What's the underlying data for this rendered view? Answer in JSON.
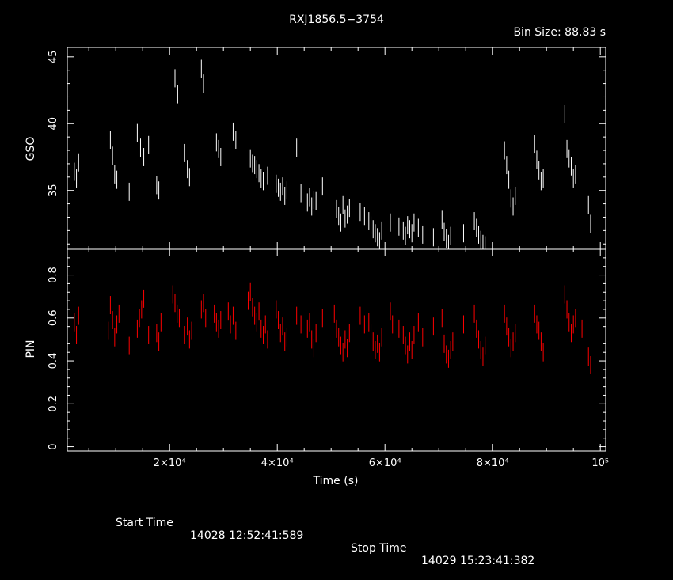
{
  "chart_data": [
    {
      "type": "scatter",
      "title": "RXJ1856.5−3754",
      "subtitle": "Bin Size: 88.83 s",
      "xlabel": "Time (s)",
      "ylabel": "GSO",
      "xlim": [
        1000,
        101000
      ],
      "ylim": [
        30.6,
        45.7
      ],
      "yticks": [
        35,
        40,
        45
      ],
      "series": [
        {
          "color": "#ffffff",
          "x": [
            2300,
            2700,
            3100,
            9000,
            9400,
            9800,
            10200,
            12500,
            14000,
            14600,
            15200,
            16100,
            17600,
            18000,
            21000,
            21500,
            22800,
            23300,
            23700,
            25900,
            26300,
            28700,
            29100,
            29500,
            31800,
            32300,
            35000,
            35400,
            35800,
            36200,
            36600,
            37000,
            37400,
            38200,
            39800,
            40200,
            40600,
            41000,
            41400,
            41800,
            43600,
            44400,
            45600,
            46000,
            46400,
            46800,
            47200,
            48400,
            51000,
            51400,
            51800,
            52200,
            52600,
            53000,
            53400,
            55400,
            56200,
            57000,
            57400,
            57800,
            58200,
            58600,
            59000,
            59400,
            61000,
            62600,
            63400,
            63800,
            64200,
            64600,
            65000,
            65400,
            66200,
            67000,
            69000,
            70600,
            71000,
            71400,
            71800,
            72200,
            74600,
            76600,
            77000,
            77400,
            77800,
            78200,
            78600,
            82200,
            82600,
            83000,
            83400,
            83800,
            84200,
            87800,
            88200,
            88600,
            89000,
            89400,
            93400,
            93800,
            94200,
            94600,
            95000,
            95400,
            97800,
            98200
          ],
          "y": [
            36.4,
            35.9,
            37.1,
            38.8,
            37.6,
            36.2,
            35.8,
            34.9,
            39.3,
            38.2,
            37.5,
            38.4,
            35.4,
            35.0,
            43.4,
            42.2,
            37.8,
            36.6,
            36.0,
            44.1,
            43.0,
            38.6,
            38.1,
            37.5,
            39.4,
            38.8,
            37.4,
            37.0,
            36.9,
            36.6,
            36.3,
            35.9,
            35.7,
            36.1,
            35.5,
            35.2,
            34.9,
            35.3,
            34.6,
            35.0,
            38.2,
            34.8,
            34.1,
            34.5,
            33.8,
            34.3,
            34.2,
            35.3,
            33.6,
            33.1,
            32.6,
            33.9,
            32.9,
            33.2,
            33.7,
            33.4,
            33.1,
            32.7,
            32.4,
            32.1,
            31.8,
            31.5,
            31.2,
            32.0,
            32.6,
            32.3,
            32.0,
            31.6,
            32.4,
            32.1,
            31.8,
            32.6,
            32.2,
            31.7,
            31.5,
            32.8,
            31.9,
            31.4,
            31.0,
            31.6,
            31.8,
            32.7,
            32.2,
            31.7,
            31.3,
            31.0,
            30.9,
            38.0,
            36.9,
            35.8,
            34.4,
            33.8,
            34.6,
            38.5,
            37.3,
            36.5,
            35.7,
            35.9,
            40.7,
            38.1,
            37.4,
            36.8,
            35.9,
            36.2,
            33.9,
            32.5
          ]
        }
      ]
    },
    {
      "type": "scatter",
      "xlabel": "Time (s)",
      "ylabel": "PIN",
      "xlim": [
        1000,
        101000
      ],
      "ylim": [
        -0.02,
        0.92
      ],
      "yticks": [
        0,
        0.2,
        0.4,
        0.6,
        0.8
      ],
      "xticks": [
        20000,
        40000,
        60000,
        80000,
        100000
      ],
      "xtick_labels": [
        "2×10⁴",
        "4×10⁴",
        "6×10⁴",
        "8×10⁴",
        "10⁵"
      ],
      "series": [
        {
          "color": "#ff0000",
          "x": [
            2300,
            2700,
            3100,
            8600,
            9000,
            9400,
            9800,
            10200,
            10600,
            12500,
            14000,
            14400,
            14800,
            15200,
            16100,
            17600,
            18000,
            18400,
            20600,
            21000,
            21400,
            21800,
            22800,
            23300,
            23700,
            24100,
            25900,
            26300,
            26700,
            28300,
            28700,
            29100,
            29500,
            30900,
            31300,
            31800,
            32300,
            34600,
            35000,
            35400,
            35800,
            36200,
            36600,
            37000,
            37400,
            37800,
            38200,
            39800,
            40200,
            40600,
            41000,
            41400,
            41800,
            43600,
            44400,
            45600,
            46000,
            46400,
            46800,
            47200,
            48400,
            50600,
            51000,
            51400,
            51800,
            52200,
            52600,
            53000,
            53400,
            55400,
            56200,
            57000,
            57400,
            57800,
            58200,
            58600,
            59000,
            59400,
            61000,
            61400,
            62600,
            63400,
            63800,
            64200,
            64600,
            65000,
            65400,
            66200,
            67000,
            69000,
            70600,
            71000,
            71400,
            71800,
            72200,
            72600,
            74600,
            76600,
            77000,
            77400,
            77800,
            78200,
            78600,
            82200,
            82600,
            83000,
            83400,
            83800,
            84200,
            87800,
            88200,
            88600,
            89000,
            89400,
            93400,
            93800,
            94200,
            94600,
            95000,
            95400,
            96600,
            97800,
            98200
          ],
          "y": [
            0.58,
            0.52,
            0.61,
            0.54,
            0.66,
            0.59,
            0.51,
            0.57,
            0.62,
            0.47,
            0.55,
            0.6,
            0.64,
            0.69,
            0.52,
            0.53,
            0.49,
            0.58,
            0.71,
            0.67,
            0.62,
            0.6,
            0.52,
            0.56,
            0.5,
            0.54,
            0.64,
            0.67,
            0.6,
            0.62,
            0.58,
            0.55,
            0.59,
            0.63,
            0.57,
            0.61,
            0.54,
            0.68,
            0.72,
            0.65,
            0.61,
            0.58,
            0.63,
            0.55,
            0.52,
            0.57,
            0.5,
            0.64,
            0.59,
            0.53,
            0.56,
            0.49,
            0.51,
            0.61,
            0.57,
            0.55,
            0.58,
            0.5,
            0.46,
            0.53,
            0.6,
            0.62,
            0.55,
            0.51,
            0.47,
            0.44,
            0.5,
            0.46,
            0.53,
            0.61,
            0.57,
            0.58,
            0.53,
            0.49,
            0.45,
            0.48,
            0.44,
            0.51,
            0.63,
            0.57,
            0.55,
            0.52,
            0.47,
            0.43,
            0.49,
            0.45,
            0.52,
            0.58,
            0.51,
            0.56,
            0.6,
            0.48,
            0.43,
            0.41,
            0.45,
            0.49,
            0.57,
            0.62,
            0.55,
            0.5,
            0.45,
            0.42,
            0.47,
            0.62,
            0.56,
            0.51,
            0.46,
            0.49,
            0.53,
            0.62,
            0.57,
            0.54,
            0.49,
            0.44,
            0.71,
            0.64,
            0.58,
            0.53,
            0.57,
            0.6,
            0.55,
            0.42,
            0.38
          ]
        }
      ]
    }
  ],
  "footer": {
    "start_label": "Start Time",
    "start_value": "14028 12:52:41:589",
    "stop_label": "Stop Time",
    "stop_value": "14029 15:23:41:382"
  }
}
